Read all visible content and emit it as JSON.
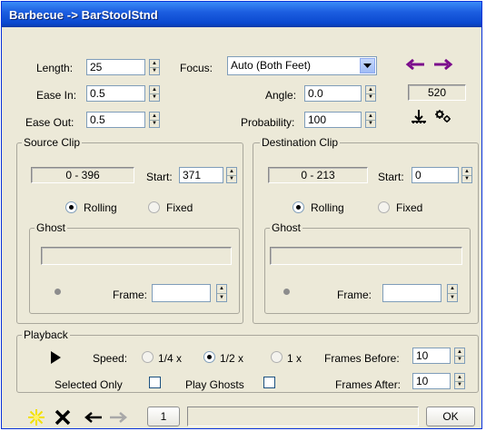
{
  "window": {
    "title": "Barbecue -> BarStoolStnd"
  },
  "params": {
    "length_label": "Length:",
    "length_value": "25",
    "ease_in_label": "Ease In:",
    "ease_in_value": "0.5",
    "ease_out_label": "Ease Out:",
    "ease_out_value": "0.5",
    "focus_label": "Focus:",
    "focus_value": "Auto (Both Feet)",
    "angle_label": "Angle:",
    "angle_value": "0.0",
    "probability_label": "Probability:",
    "probability_value": "100",
    "frame_count": "520"
  },
  "source_clip": {
    "title": "Source Clip",
    "range": "0 - 396",
    "start_label": "Start:",
    "start_value": "371",
    "rolling_label": "Rolling",
    "fixed_label": "Fixed",
    "selected_mode": "Rolling",
    "ghost_title": "Ghost",
    "ghost_value": "",
    "frame_label": "Frame:",
    "frame_value": ""
  },
  "destination_clip": {
    "title": "Destination Clip",
    "range": "0 - 213",
    "start_label": "Start:",
    "start_value": "0",
    "rolling_label": "Rolling",
    "fixed_label": "Fixed",
    "selected_mode": "Rolling",
    "ghost_title": "Ghost",
    "ghost_value": "",
    "frame_label": "Frame:",
    "frame_value": ""
  },
  "playback": {
    "title": "Playback",
    "speed_label": "Speed:",
    "speed_options": [
      "1/4 x",
      "1/2 x",
      "1 x"
    ],
    "speed_selected": "1/2 x",
    "frames_before_label": "Frames Before:",
    "frames_before_value": "10",
    "frames_after_label": "Frames After:",
    "frames_after_value": "10",
    "selected_only_label": "Selected Only",
    "play_ghosts_label": "Play Ghosts"
  },
  "bottom": {
    "index": "1",
    "status_text": "",
    "ok_label": "OK"
  },
  "colors": {
    "title_bar": "#0a48cf",
    "arrow_accent": "#7b0c8c",
    "window_bg": "#ece9d8"
  }
}
